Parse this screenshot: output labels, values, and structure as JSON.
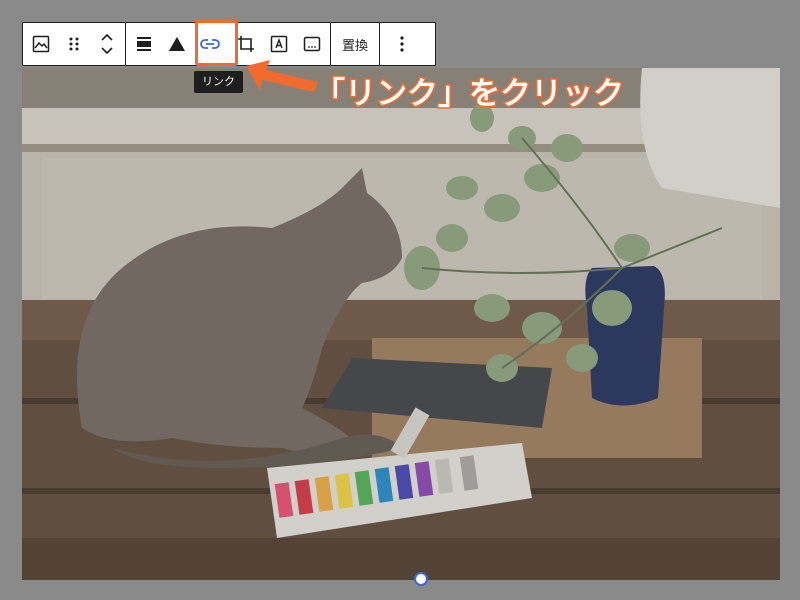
{
  "toolbar": {
    "replace_label": "置換",
    "buttons": [
      {
        "name": "image-icon"
      },
      {
        "name": "drag-handle-icon"
      },
      {
        "name": "move-up-down-icon"
      },
      {
        "name": "align-icon"
      },
      {
        "name": "duotone-icon"
      },
      {
        "name": "link-icon"
      },
      {
        "name": "crop-icon"
      },
      {
        "name": "text-overlay-icon"
      },
      {
        "name": "alt-text-icon"
      },
      {
        "name": "more-options-icon"
      }
    ]
  },
  "tooltip": {
    "text": "リンク"
  },
  "annotation": {
    "text": "「リンク」をクリック",
    "color": "#f26a2e"
  },
  "image": {
    "alt": "cat with paint tubes and plant"
  },
  "colors": {
    "toolbar_border": "#1e1e1e",
    "link_active": "#3a6ad8",
    "highlight": "#f26a2e"
  }
}
